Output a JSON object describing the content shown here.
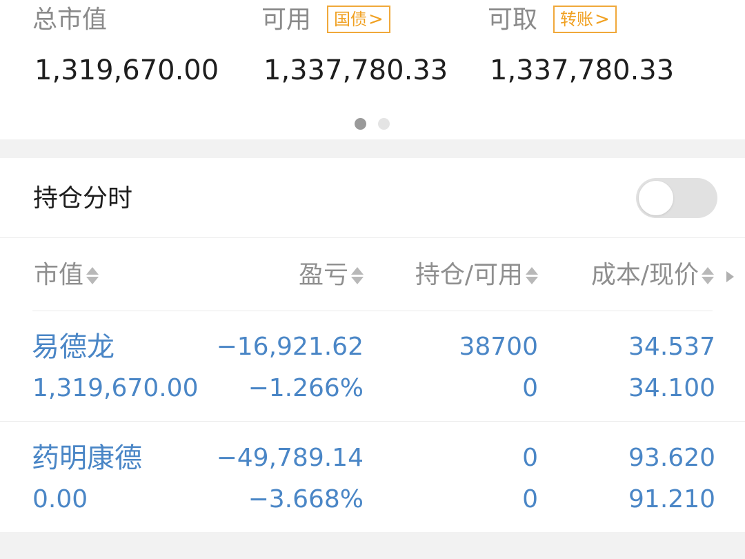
{
  "summary": {
    "market_value_label": "总市值",
    "market_value": "1,319,670.00",
    "available_label": "可用",
    "available_tag": "国债",
    "available_value": "1,337,780.33",
    "withdrawable_label": "可取",
    "withdrawable_tag": "转账",
    "withdrawable_value": "1,337,780.33",
    "pager": {
      "pages": 2,
      "active": 1
    }
  },
  "toggle": {
    "label": "持仓分时",
    "on": false
  },
  "table": {
    "headers": [
      "市值",
      "盈亏",
      "持仓/可用",
      "成本/现价"
    ],
    "rows": [
      {
        "name": "易德龙",
        "market_value": "1,319,670.00",
        "pnl": "−16,921.62",
        "pnl_ratio": "−1.266%",
        "position": "38700",
        "available": "0",
        "cost": "34.537",
        "price": "34.100"
      },
      {
        "name": "药明康德",
        "market_value": "0.00",
        "pnl": "−49,789.14",
        "pnl_ratio": "−3.668%",
        "position": "0",
        "available": "0",
        "cost": "93.620",
        "price": "91.210"
      }
    ]
  },
  "colors": {
    "accent_blue": "#4a86c6",
    "tag_orange": "#f0a020",
    "label_gray": "#8a8a8a",
    "value_dark": "#1e1e1e",
    "background": "#f2f2f2"
  }
}
